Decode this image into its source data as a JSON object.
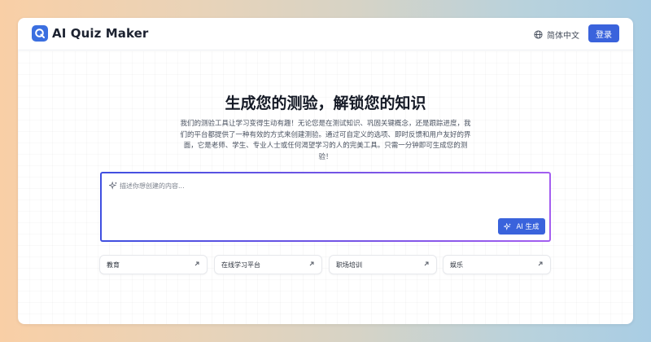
{
  "header": {
    "logo_text": "AI Quiz Maker",
    "language_label": "简体中文",
    "login_label": "登录"
  },
  "hero": {
    "title": "生成您的测验，解锁您的知识",
    "description": "我们的测验工具让学习变得生动有趣！无论您是在测试知识、巩固关键概念，还是跟踪进度，我们的平台都提供了一种有效的方式来创建测验。通过可自定义的选项、即时反馈和用户友好的界面，它是老师、学生、专业人士或任何渴望学习的人的完美工具。只需一分钟即可生成您的测验！"
  },
  "prompt": {
    "placeholder": "描述你想创建的内容...",
    "value": "",
    "generate_label": "AI 生成"
  },
  "categories": [
    {
      "label": "教育"
    },
    {
      "label": "在线学习平台"
    },
    {
      "label": "职场培训"
    },
    {
      "label": "娱乐"
    }
  ],
  "colors": {
    "accent": "#3a63dc",
    "border_gradient_start": "#3f4fe0",
    "border_gradient_end": "#a35ef0"
  }
}
